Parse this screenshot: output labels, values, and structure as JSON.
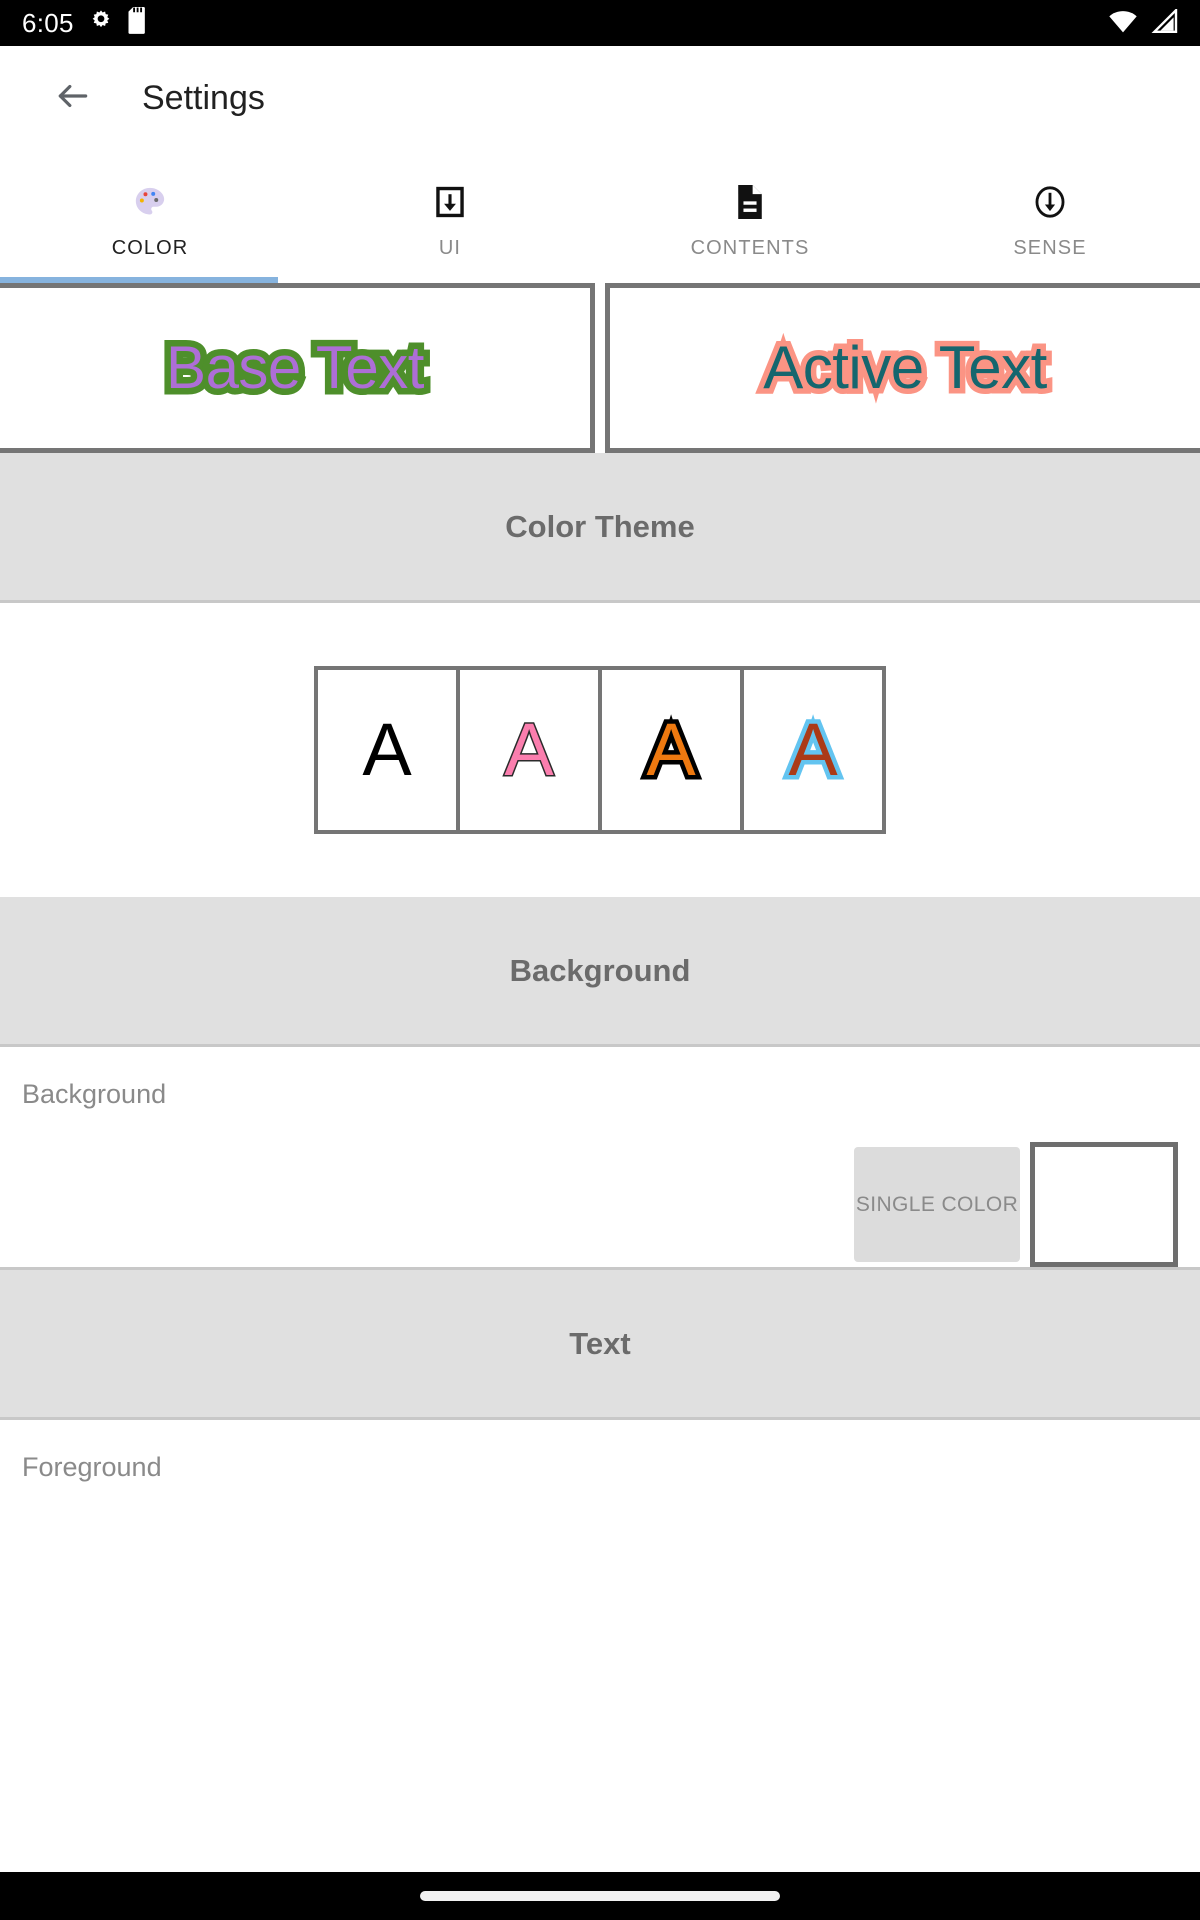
{
  "status_bar": {
    "time": "6:05",
    "left_icons": [
      "gear-icon",
      "sd-card-icon"
    ],
    "right_icons": [
      "wifi-icon",
      "cellular-signal-icon"
    ],
    "background": "#000000",
    "foreground": "#ffffff"
  },
  "app_bar": {
    "back_label": "back-arrow",
    "title": "Settings"
  },
  "tabs": {
    "active_index": 0,
    "indicator_color": "#86b3de",
    "items": [
      {
        "label": "COLOR",
        "icon": "palette-icon"
      },
      {
        "label": "UI",
        "icon": "download-box-icon"
      },
      {
        "label": "CONTENTS",
        "icon": "document-icon"
      },
      {
        "label": "SENSE",
        "icon": "circle-down-arrow-icon"
      }
    ]
  },
  "preview": {
    "base": {
      "text": "Base Text",
      "fill": "#ad6ed6",
      "stroke": "#4e8f2b"
    },
    "active": {
      "text": "Active Text",
      "fill": "#15666e",
      "stroke": "#fb9484"
    },
    "border_color": "#757575"
  },
  "sections": {
    "color_theme": {
      "title": "Color Theme",
      "swatches": [
        {
          "letter": "A",
          "fill": "#000000",
          "stroke": "none"
        },
        {
          "letter": "A",
          "fill": "#fb7eae",
          "stroke": "#2b2b2b"
        },
        {
          "letter": "A",
          "fill": "#ee7910",
          "stroke": "#000000"
        },
        {
          "letter": "A",
          "fill": "#ab3a17",
          "stroke": "#63c4f0"
        }
      ]
    },
    "background": {
      "title": "Background",
      "row_label": "Background",
      "mode_button": "SINGLE COLOR",
      "swatch_color": "#ffffff"
    },
    "text": {
      "title": "Text",
      "row_label": "Foreground"
    }
  },
  "nav_bar": {
    "gesture_pill": "home-gesture-pill"
  }
}
